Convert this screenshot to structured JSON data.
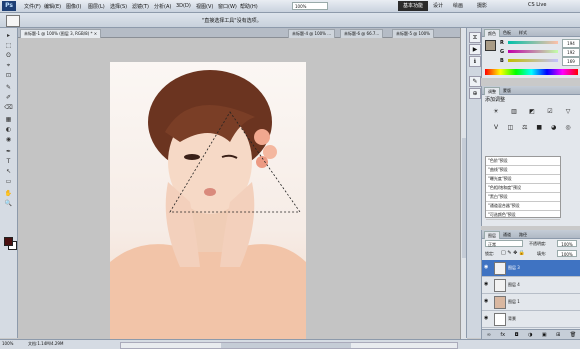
{
  "app": {
    "logo": "Ps"
  },
  "menu": [
    "文件(F)",
    "编辑(E)",
    "图像(I)",
    "图层(L)",
    "选择(S)",
    "滤镜(T)",
    "分析(A)",
    "3D(D)",
    "视图(V)",
    "窗口(W)",
    "帮助(H)"
  ],
  "zoom_field": "100%",
  "workspaces": [
    {
      "label": "基本功能",
      "active": true
    },
    {
      "label": "设计",
      "active": false
    },
    {
      "label": "绘画",
      "active": false
    },
    {
      "label": "摄影",
      "active": false
    }
  ],
  "cs_live": "CS Live",
  "window_controls": [
    "−",
    "□",
    "×"
  ],
  "options": {
    "hint": "\"直接选择工具\"没有选项。"
  },
  "tabs": [
    {
      "label": "未标题-1 @ 100% (图层 3, RGB/8) * ×",
      "active": true
    },
    {
      "label": "未标题-4 @ 100% ...",
      "active": false
    },
    {
      "label": "未标题-6 @ 66.7...",
      "active": false
    },
    {
      "label": "未标题-5 @ 100%",
      "active": false
    }
  ],
  "tools": [
    "▸",
    "⬚",
    "ʘ",
    "⌖",
    "⊡",
    "✎",
    "✐",
    "⌫",
    "▦",
    "◐",
    "◉",
    "✒",
    "T",
    "↖",
    "▭",
    "✋",
    "🔍"
  ],
  "status": {
    "zoom": "100%",
    "doc": "文档:1.14M/4.29M"
  },
  "color_panel": {
    "tabs": [
      "颜色",
      "色板",
      "样式"
    ],
    "fg": "#a99b86",
    "channels": [
      {
        "label": "R",
        "value": "194",
        "gradient": "linear-gradient(90deg,#00c0a9,#ffc0a9)"
      },
      {
        "label": "G",
        "value": "192",
        "gradient": "linear-gradient(90deg,#c200a9,#c2ffa9)"
      },
      {
        "label": "B",
        "value": "169",
        "gradient": "linear-gradient(90deg,#c2c000,#c2c0ff)"
      }
    ]
  },
  "adjust_panel": {
    "tabs": [
      "调整",
      "蒙版"
    ],
    "title": "添加调整",
    "icons_row1": [
      "☀",
      "▥",
      "◩",
      "☑",
      "▽"
    ],
    "icons_row2": [
      "V",
      "◫",
      "⚖",
      "■",
      "◕",
      "◎"
    ],
    "presets": [
      "\"色阶\"预设",
      "\"曲线\"预设",
      "\"曝光度\"预设",
      "\"色相/饱和度\"预设",
      "\"黑白\"预设",
      "\"通道混合器\"预设",
      "\"可选颜色\"预设"
    ]
  },
  "layers_panel": {
    "tabs": [
      "图层",
      "通道",
      "路径"
    ],
    "blend": "正常",
    "opacity_label": "不透明度:",
    "opacity": "100%",
    "lock_label": "锁定:",
    "fill_label": "填充:",
    "fill": "100%",
    "layers": [
      {
        "name": "图层 3",
        "selected": true,
        "thumb": "#f2f2f2"
      },
      {
        "name": "图层 4",
        "selected": false,
        "thumb": "#f2f2f2"
      },
      {
        "name": "图层 1",
        "selected": false,
        "thumb": "#d9b7a0"
      },
      {
        "name": "背景",
        "selected": false,
        "thumb": "#ffffff"
      }
    ],
    "footer_icons": [
      "∞",
      "fx",
      "◘",
      "◑",
      "▣",
      "⊞",
      "🗑"
    ]
  }
}
